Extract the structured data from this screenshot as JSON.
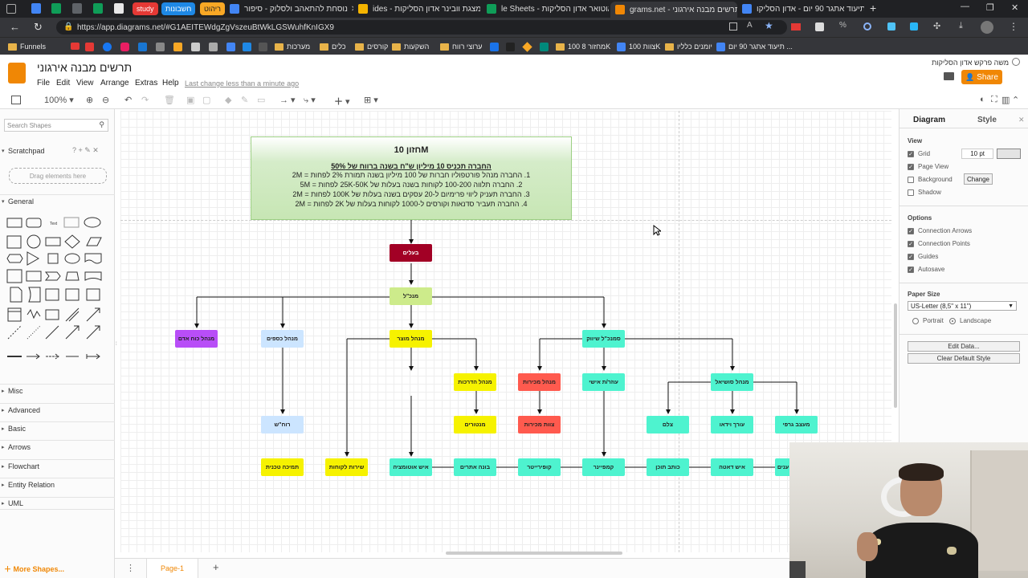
{
  "browser": {
    "tabs": [
      {
        "label": "נוסחת להתאהב ולסלוק - סיפור",
        "color": "#4285f4"
      },
      {
        "label": "ides - מצגת וובינר אדון הסליקות",
        "color": "#f4b400"
      },
      {
        "label": "le Sheets - אוטואר אדון הסליקות",
        "color": "#0f9d58"
      },
      {
        "label": "grams.net - תרשים מבנה אירגוני",
        "color": "#f08705",
        "active": true
      },
      {
        "label": "תיעוד אתגר 90 יום - אדון הסליקו",
        "color": "#4285f4"
      }
    ],
    "pinned": [
      "study",
      "חשבונות",
      "ריהוט"
    ],
    "url": "https://app.diagrams.net/#G1AEITEWdgZgVszeuBtWkLGSWuhfKnIGX9",
    "bookmarks": [
      "Funnels",
      "מערכות",
      "כלים",
      "קורסים",
      "השקעות",
      "ערוצי רווח",
      "מחזור 8 100K",
      "צוות 100K",
      "יומנים כלליו",
      "תיעוד אתגר 90 יום ..."
    ]
  },
  "app": {
    "title": "תרשים מבנה אירגוני",
    "menu": [
      "File",
      "Edit",
      "View",
      "Arrange",
      "Extras",
      "Help"
    ],
    "last_change": "Last change less than a minute ago",
    "user": "משה פרקש אדון הסליקות",
    "share_label": "Share",
    "zoom": "100%"
  },
  "left_panel": {
    "search_placeholder": "Search Shapes",
    "scratchpad": "Scratchpad",
    "drag_hint": "Drag elements here",
    "sections": [
      "General",
      "Misc",
      "Advanced",
      "Basic",
      "Arrows",
      "Flowchart",
      "Entity Relation",
      "UML"
    ],
    "more_shapes": "More Shapes..."
  },
  "right_panel": {
    "tabs": [
      "Diagram",
      "Style"
    ],
    "view_label": "View",
    "view_options": [
      {
        "label": "Grid",
        "checked": true
      },
      {
        "label": "Page View",
        "checked": true
      },
      {
        "label": "Background",
        "checked": false
      },
      {
        "label": "Shadow",
        "checked": false
      }
    ],
    "grid_size": "10 pt",
    "change_label": "Change",
    "options_label": "Options",
    "options": [
      {
        "label": "Connection Arrows",
        "checked": true
      },
      {
        "label": "Connection Points",
        "checked": true
      },
      {
        "label": "Guides",
        "checked": true
      },
      {
        "label": "Autosave",
        "checked": true
      }
    ],
    "paper_size_label": "Paper Size",
    "paper_size": "US-Letter (8,5\" x 11\")",
    "orientation": [
      "Portrait",
      "Landscape"
    ],
    "edit_data": "Edit Data...",
    "clear_style": "Clear Default Style"
  },
  "diagram": {
    "vision_title": "חזון 10M",
    "vision_sub": "החברה תכניס 10 מיליון ש\"ח בשנה ברווח של 50%",
    "vision_lines": [
      "1. החברה מנהל פורטפוליו חברות של 100 מיליון בשנה תמורת 2% לפחות = 2M",
      "2. החברה תלווה 100-200 לקוחות בשנה בעלות של 25K-50K לפחות = 5M",
      "3. החברה תעניק ליווי פרימיום ל-20 עסקים בשנה בעלות של 100K לפחות = 2M",
      "4. החברה תעביר סדנאות וקורסים ל-1000 לקוחות בעלות של 2K לפחות = 2M"
    ],
    "nodes": {
      "owners": "בעלים",
      "ceo": "מנכ\"ל",
      "hr": "מנהל כוח אדם",
      "finance": "מנהל כספים",
      "product": "מנהל מוצר",
      "marketing_ceo": "סמנכ\"ל שיווק",
      "training": "מנהל הדרכות",
      "sales_mgr": "מנהל מכירות",
      "personal_brand": "עוזר/ת אישי",
      "social": "מנהל סושיאל",
      "accountant": "רוח\"ש",
      "mentors": "מנטורים",
      "sales_team": "צוות מכירות",
      "photo": "צלם",
      "video_editor": "עורך וידאו",
      "designer": "מעצב גרפי",
      "tech_support": "תמיכה טכנית",
      "customer_service": "שירות לקוחות",
      "automation": "איש אוטומציה",
      "web_builder": "בונה אתרים",
      "copywriter": "קופירייטר",
      "campaigner": "קמפיינר",
      "content_writer": "כותב תוכן",
      "cold_call": "איש דאטה",
      "last_partial": "ענים"
    }
  },
  "page_tab": "Page-1"
}
